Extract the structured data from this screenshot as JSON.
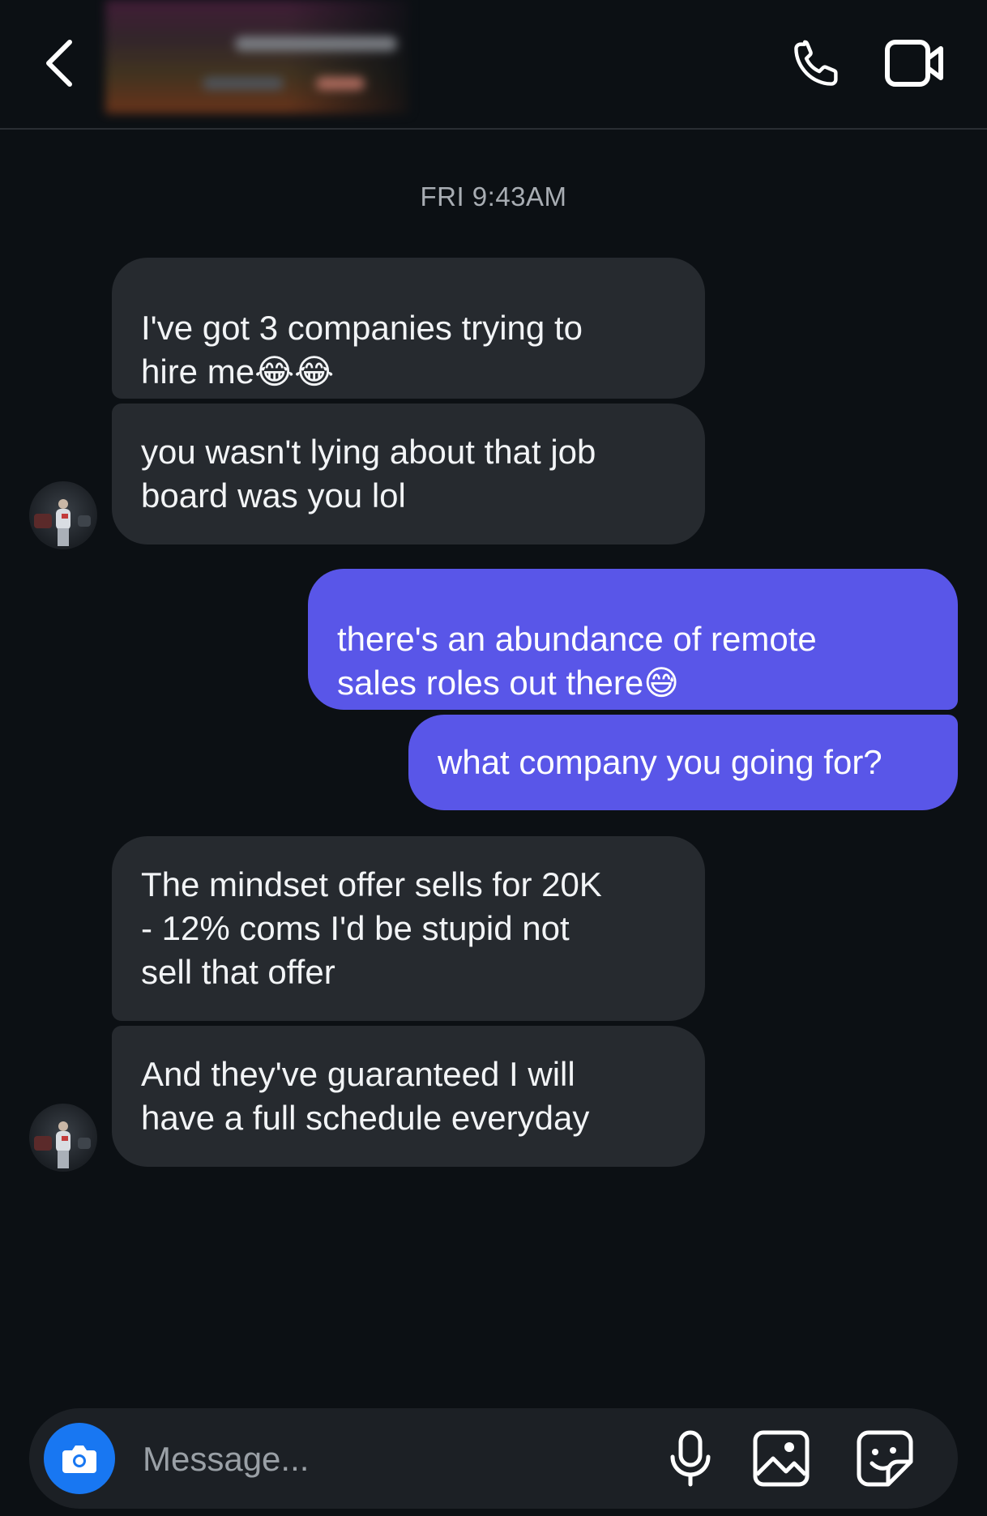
{
  "header": {
    "back_icon": "chevron-left-icon",
    "call_icon": "phone-icon",
    "video_icon": "video-camera-icon"
  },
  "thread": {
    "timestamp": "FRI 9:43AM",
    "messages": [
      {
        "direction": "incoming",
        "text": "I've got 3 companies trying to\nhire me",
        "emoji": "😂😂"
      },
      {
        "direction": "incoming",
        "text": "you wasn't lying about that job\nboard was you lol",
        "emoji": ""
      },
      {
        "direction": "outgoing",
        "text": "there's an abundance of remote\nsales roles out there",
        "emoji": "😅"
      },
      {
        "direction": "outgoing",
        "text": "what company you going for?",
        "emoji": ""
      },
      {
        "direction": "incoming",
        "text": "The mindset offer sells for 20K\n- 12% coms I'd be stupid not\nsell that offer",
        "emoji": ""
      },
      {
        "direction": "incoming",
        "text": "And they've guaranteed I will\nhave a full schedule everyday",
        "emoji": ""
      }
    ]
  },
  "composer": {
    "placeholder": "Message...",
    "camera_icon": "camera-icon",
    "mic_icon": "microphone-icon",
    "gallery_icon": "image-gallery-icon",
    "sticker_icon": "sticker-icon"
  },
  "colors": {
    "background": "#0c1014",
    "incoming_bubble": "#262a2f",
    "outgoing_bubble": "#5956e8",
    "camera_button": "#1877f2"
  }
}
